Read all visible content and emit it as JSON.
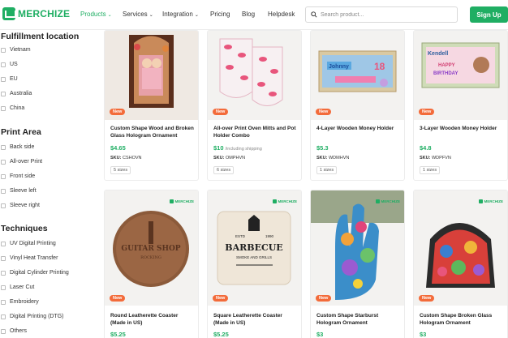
{
  "header": {
    "logo_text": "MERCHIZE",
    "nav": [
      {
        "label": "Products",
        "caret": "⌄",
        "active": true
      },
      {
        "label": "Services",
        "caret": "⌄"
      },
      {
        "label": "Integration",
        "caret": "⌄"
      },
      {
        "label": "Pricing"
      },
      {
        "label": "Blog"
      },
      {
        "label": "Helpdesk"
      }
    ],
    "search_placeholder": "Search product...",
    "signup_label": "Sign Up"
  },
  "sidebar": {
    "fulfillment": {
      "title": "Fulfillment location",
      "options": [
        "Vietnam",
        "US",
        "EU",
        "Australia",
        "China"
      ]
    },
    "print_area": {
      "title": "Print Area",
      "options": [
        "Back side",
        "All-over Print",
        "Front side",
        "Sleeve left",
        "Sleeve right"
      ]
    },
    "techniques": {
      "title": "Techniques",
      "options": [
        "UV Digital Printing",
        "Vinyl Heat Transfer",
        "Digital Cylinder Printing",
        "Laser Cut",
        "Embroidery",
        "Digital Printing (DTG)",
        "Others"
      ]
    }
  },
  "products": [
    {
      "title": "Custom Shape Wood and Broken Glass Hologram Ornament",
      "price": "$4.65",
      "price_note": "",
      "sku_label": "SKU:",
      "sku": "CSHOVN",
      "sizes": "5 sizes",
      "badge": "New"
    },
    {
      "title": "All-over Print Oven Mitts and Pot Holder Combo",
      "price": "$10",
      "price_note": "/including shipping",
      "sku_label": "SKU:",
      "sku": "OMPHVN",
      "sizes": "6 sizes",
      "badge": "New"
    },
    {
      "title": "4-Layer Wooden Money Holder",
      "price": "$5.3",
      "price_note": "",
      "sku_label": "SKU:",
      "sku": "WDMHVN",
      "sizes": "1 sizes",
      "badge": "New"
    },
    {
      "title": "3-Layer Wooden Money Holder",
      "price": "$4.8",
      "price_note": "",
      "sku_label": "SKU:",
      "sku": "WDPFVN",
      "sizes": "1 sizes",
      "badge": "New"
    },
    {
      "title": "Round Leatherette Coaster (Made in US)",
      "price": "$5.25",
      "badge": "New",
      "brand": "MERCHIZE",
      "art_text": [
        "GUITAR SHOP",
        "ROCKING"
      ]
    },
    {
      "title": "Square Leatherette Coaster (Made in US)",
      "price": "$5.25",
      "badge": "New",
      "brand": "MERCHIZE",
      "art_text": [
        "ESTD",
        "1990",
        "BARBECUE",
        "SMOKE AND GRILLS"
      ]
    },
    {
      "title": "Custom Shape Starburst Hologram Ornament",
      "price": "$3",
      "badge": "New",
      "brand": "MERCHIZE"
    },
    {
      "title": "Custom Shape Broken Glass Hologram Ornament",
      "price": "$3",
      "badge": "New",
      "brand": "MERCHIZE"
    }
  ],
  "colors": {
    "brand": "#1fae63",
    "badge": "#f36b3a"
  },
  "icons": [
    "merchize-logo-icon",
    "search-icon",
    "chevron-down-icon",
    "checkbox-icon"
  ]
}
